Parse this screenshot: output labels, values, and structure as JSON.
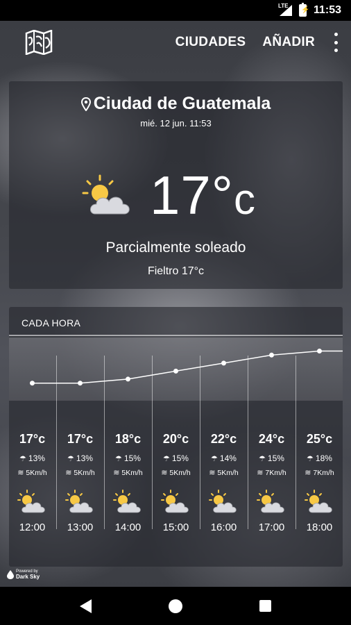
{
  "status_bar": {
    "network": "LTE",
    "battery_glyph": "⚡",
    "time": "11:53"
  },
  "app_bar": {
    "cities_label": "CIUDADES",
    "add_label": "AÑADIR"
  },
  "current": {
    "city": "Ciudad de Guatemala",
    "datetime": "mié. 12 jun. 11:53",
    "temperature": "17°",
    "unit": "c",
    "condition": "Parcialmente soleado",
    "feels_like": "Fieltro 17°c",
    "icon": "partly-sunny-icon"
  },
  "hourly": {
    "title": "CADA HORA",
    "rain_icon": "☂",
    "wind_icon": "≋",
    "hours": [
      {
        "temp": "17°c",
        "rain": "13%",
        "wind": "5Km/h",
        "time": "12:00",
        "value": 17
      },
      {
        "temp": "17°c",
        "rain": "13%",
        "wind": "5Km/h",
        "time": "13:00",
        "value": 17
      },
      {
        "temp": "18°c",
        "rain": "15%",
        "wind": "5Km/h",
        "time": "14:00",
        "value": 18
      },
      {
        "temp": "20°c",
        "rain": "15%",
        "wind": "5Km/h",
        "time": "15:00",
        "value": 20
      },
      {
        "temp": "22°c",
        "rain": "14%",
        "wind": "5Km/h",
        "time": "16:00",
        "value": 22
      },
      {
        "temp": "24°c",
        "rain": "15%",
        "wind": "7Km/h",
        "time": "17:00",
        "value": 24
      },
      {
        "temp": "25°c",
        "rain": "18%",
        "wind": "7Km/h",
        "time": "18:00",
        "value": 25
      }
    ]
  },
  "powered_by": {
    "line1": "Powered by",
    "line2": "Dark Sky"
  },
  "colors": {
    "sun": "#f7c845",
    "cloud": "#d9dadf",
    "accent": "#ffffff"
  }
}
